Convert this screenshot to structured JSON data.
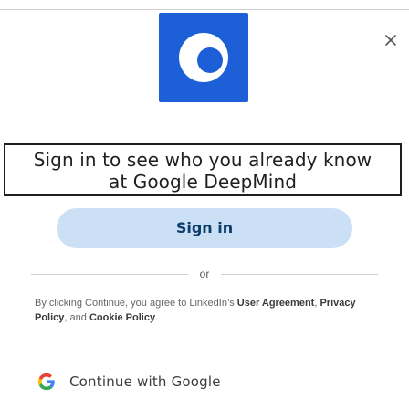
{
  "dialog": {
    "headline_line1": "Sign in to see who you already know",
    "headline_line2": "at Google DeepMind",
    "signin_label": "Sign in",
    "divider_text": "or",
    "legal": {
      "prefix": "By clicking Continue, you agree to LinkedIn’s ",
      "user_agreement": "User Agreement",
      "sep1": ", ",
      "privacy_policy": "Privacy Policy",
      "sep2": ", and ",
      "cookie_policy": "Cookie Policy",
      "suffix": "."
    },
    "google_label": "Continue with Google"
  },
  "icons": {
    "close": "close-icon",
    "logo": "company-logo-icon",
    "google": "google-icon"
  },
  "colors": {
    "signin_bg": "#cce0f5",
    "signin_text": "#0a3d6b",
    "border": "#1f1f1f"
  }
}
